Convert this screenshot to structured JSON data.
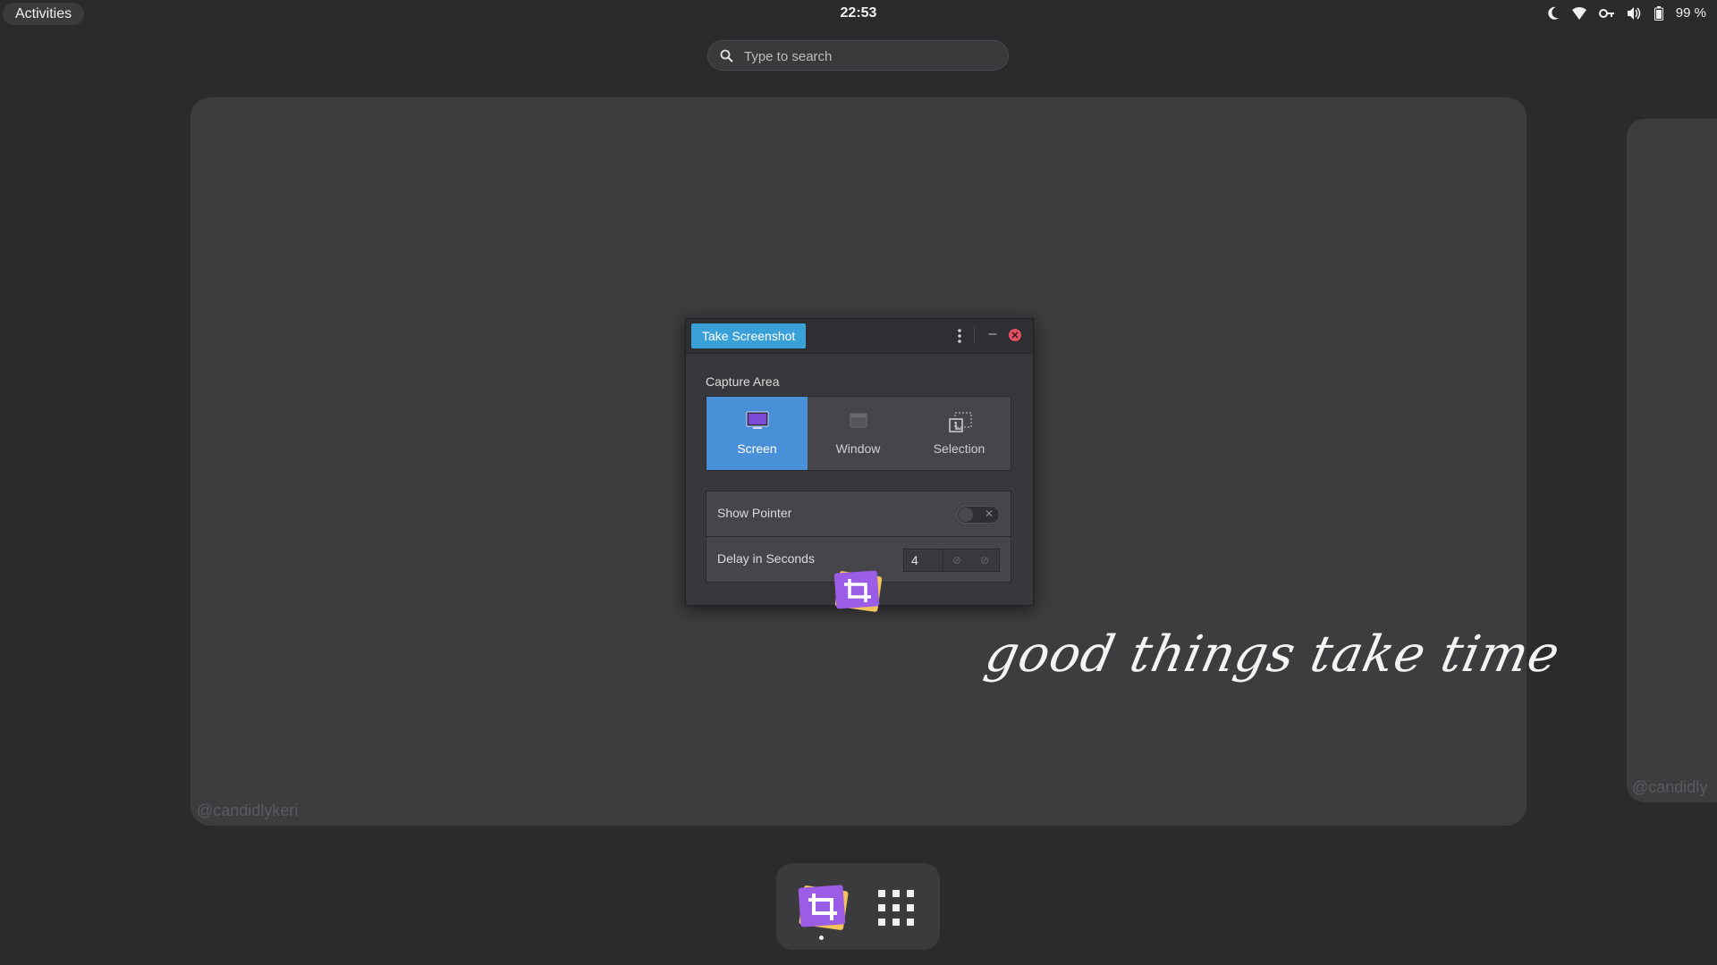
{
  "topbar": {
    "activities_label": "Activities",
    "clock": "22:53",
    "battery_percent": "99 %",
    "tray_icons": [
      "night-light-icon",
      "wifi-icon",
      "vpn-key-icon",
      "volume-icon",
      "battery-icon"
    ]
  },
  "search": {
    "placeholder": "Type to search"
  },
  "workspace": {
    "watermark": "@candidlykeri",
    "watermark_right": "@candidly",
    "script_text": "good things take time"
  },
  "dialog": {
    "title": "Take Screenshot",
    "minimize_label": "–",
    "capture_area_label": "Capture Area",
    "capture_options": [
      {
        "label": "Screen",
        "icon": "monitor-icon",
        "selected": true
      },
      {
        "label": "Window",
        "icon": "window-icon",
        "selected": false
      },
      {
        "label": "Selection",
        "icon": "selection-icon",
        "selected": false
      }
    ],
    "show_pointer_label": "Show Pointer",
    "show_pointer_on": false,
    "delay_label": "Delay in Seconds",
    "delay_value": "4"
  },
  "dash": {
    "apps": [
      "screenshot-app-icon",
      "app-grid-icon"
    ]
  },
  "colors": {
    "accent_blue": "#4a90d9",
    "title_badge": "#3aa0d8",
    "close_red": "#e05263",
    "app_purple": "#9b5de5",
    "app_yellow": "#f3c45b"
  }
}
